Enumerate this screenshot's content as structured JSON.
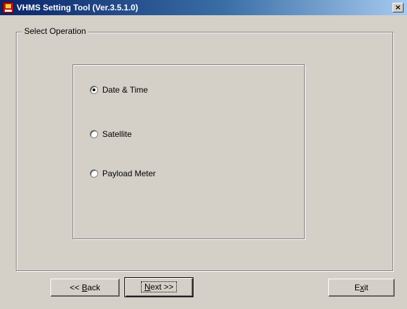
{
  "window": {
    "title": "VHMS Setting Tool (Ver.3.5.1.0)",
    "close_label": "×"
  },
  "group": {
    "legend": "Select Operation"
  },
  "options": [
    {
      "label": "Date & Time",
      "checked": true
    },
    {
      "label": "Satellite",
      "checked": false
    },
    {
      "label": "Payload Meter",
      "checked": false
    }
  ],
  "buttons": {
    "back": {
      "prefix": "<< ",
      "mnemonic": "B",
      "rest": "ack"
    },
    "next": {
      "prefix": "",
      "mnemonic": "N",
      "rest": "ext >>"
    },
    "exit": {
      "prefix": "E",
      "mnemonic": "x",
      "rest": "it"
    }
  },
  "icons": {
    "app": "vhms-app-icon",
    "close": "close-icon"
  }
}
